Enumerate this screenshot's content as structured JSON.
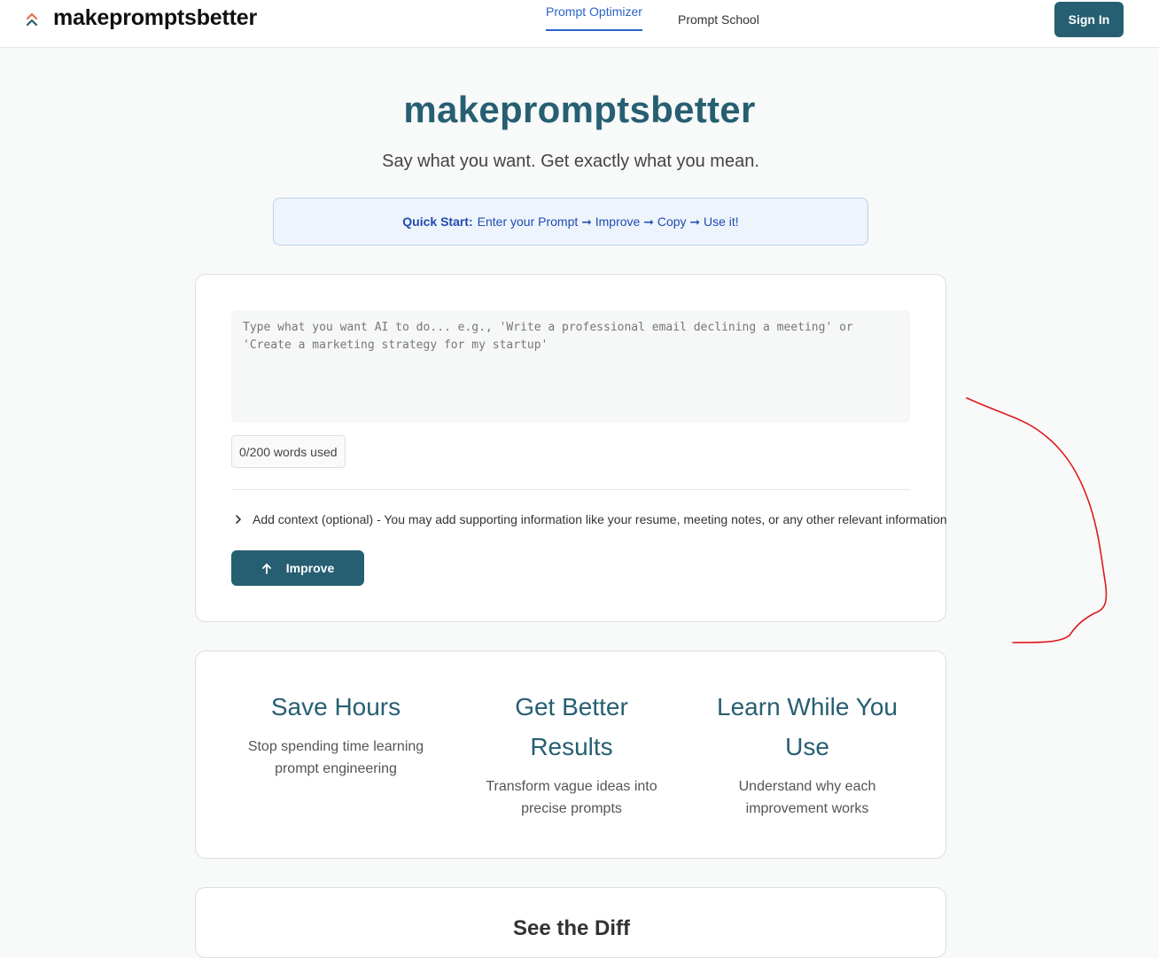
{
  "header": {
    "brand": "makepromptsbetter",
    "nav": [
      {
        "label": "Prompt Optimizer",
        "active": true
      },
      {
        "label": "Prompt School",
        "active": false
      }
    ],
    "sign_in": "Sign In"
  },
  "hero": {
    "title": "makepromptsbetter",
    "subtitle": "Say what you want. Get exactly what you mean."
  },
  "quick_start": {
    "label": "Quick Start:",
    "steps": "Enter your Prompt ➞ Improve ➞ Copy ➞ Use it!"
  },
  "prompt": {
    "placeholder": "Type what you want AI to do... e.g., 'Write a professional email declining a meeting' or 'Create a marketing strategy for my startup'",
    "value": "",
    "word_count": "0/200 words used",
    "context_toggle": "Add context (optional) - You may add supporting information like your resume, meeting notes, or any other relevant information",
    "improve_button": "Improve"
  },
  "features": [
    {
      "title": "Save Hours",
      "description": "Stop spending time learning prompt engineering"
    },
    {
      "title": "Get Better Results",
      "description": "Transform vague ideas into precise prompts"
    },
    {
      "title": "Learn While You Use",
      "description": "Understand why each improvement works"
    }
  ],
  "next_section": {
    "title": "See the Diff"
  },
  "colors": {
    "brand": "#275f72",
    "link_active": "#2b63c9",
    "quickstart_bg": "#eef4fc",
    "annotation": "#e0191c"
  },
  "icons": {
    "logo": "double-chevron-up-icon",
    "context": "chevron-right-icon",
    "improve": "arrow-up-icon"
  }
}
